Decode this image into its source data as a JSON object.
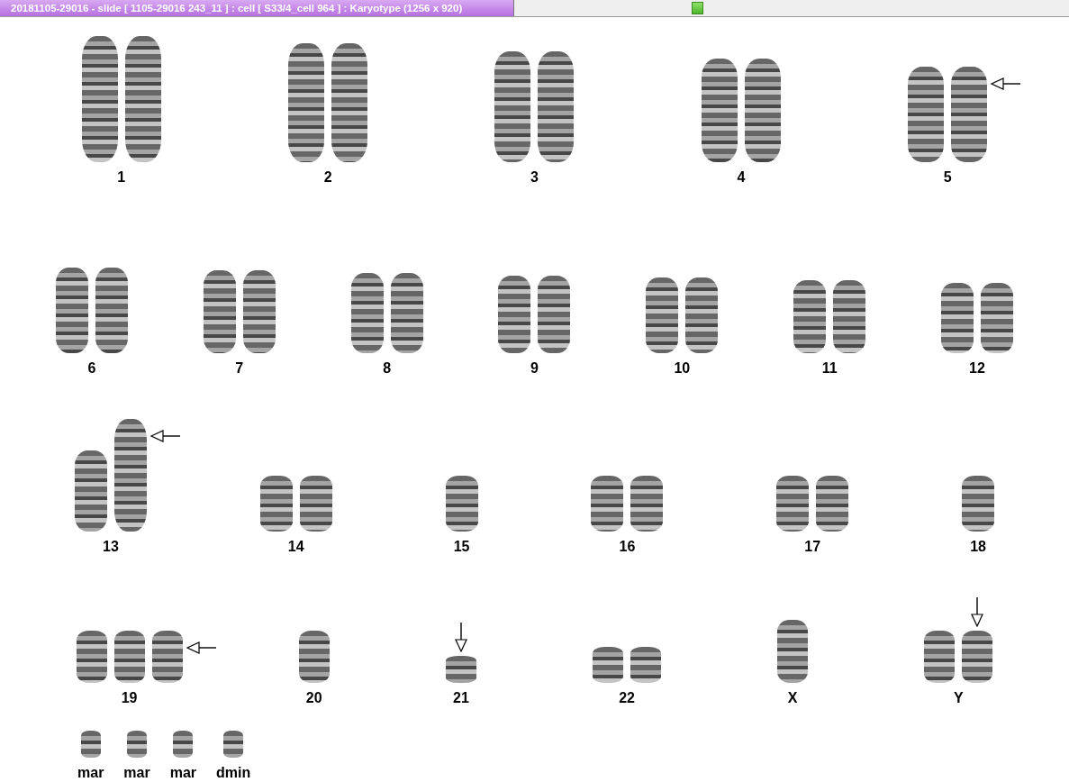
{
  "window": {
    "title": "20181105-29016 - slide [ 1105-29016 243_11 ] : cell [ S33/4_cell 964 ] : Karyotype  (1256 x 920)"
  },
  "rows": [
    {
      "groups": [
        {
          "label": "1",
          "chromosomes": [
            {
              "kind": "plain"
            },
            {
              "kind": "plain"
            }
          ]
        },
        {
          "label": "2",
          "chromosomes": [
            {
              "kind": "plain"
            },
            {
              "kind": "plain"
            }
          ]
        },
        {
          "label": "3",
          "chromosomes": [
            {
              "kind": "plain"
            },
            {
              "kind": "plain"
            }
          ]
        },
        {
          "label": "4",
          "chromosomes": [
            {
              "kind": "plain"
            },
            {
              "kind": "plain"
            }
          ]
        },
        {
          "label": "5",
          "chromosomes": [
            {
              "kind": "plain"
            },
            {
              "kind": "arrowed-side"
            }
          ]
        }
      ]
    },
    {
      "groups": [
        {
          "label": "6",
          "chromosomes": [
            {
              "kind": "plain"
            },
            {
              "kind": "plain"
            }
          ]
        },
        {
          "label": "7",
          "chromosomes": [
            {
              "kind": "plain"
            },
            {
              "kind": "plain"
            }
          ]
        },
        {
          "label": "8",
          "chromosomes": [
            {
              "kind": "plain"
            },
            {
              "kind": "plain"
            }
          ]
        },
        {
          "label": "9",
          "chromosomes": [
            {
              "kind": "plain"
            },
            {
              "kind": "plain"
            }
          ]
        },
        {
          "label": "10",
          "chromosomes": [
            {
              "kind": "plain"
            },
            {
              "kind": "plain"
            }
          ]
        },
        {
          "label": "11",
          "chromosomes": [
            {
              "kind": "plain"
            },
            {
              "kind": "plain"
            }
          ]
        },
        {
          "label": "12",
          "chromosomes": [
            {
              "kind": "plain"
            },
            {
              "kind": "plain"
            }
          ]
        }
      ]
    },
    {
      "groups": [
        {
          "label": "13",
          "chromosomes": [
            {
              "kind": "plain"
            },
            {
              "kind": "arrowed-side"
            }
          ]
        },
        {
          "label": "14",
          "chromosomes": [
            {
              "kind": "plain"
            },
            {
              "kind": "plain"
            }
          ]
        },
        {
          "label": "15",
          "chromosomes": [
            {
              "kind": "plain"
            }
          ]
        },
        {
          "label": "16",
          "chromosomes": [
            {
              "kind": "plain"
            },
            {
              "kind": "plain"
            }
          ]
        },
        {
          "label": "17",
          "chromosomes": [
            {
              "kind": "plain"
            },
            {
              "kind": "plain"
            }
          ]
        },
        {
          "label": "18",
          "chromosomes": [
            {
              "kind": "plain"
            }
          ]
        }
      ]
    },
    {
      "groups": [
        {
          "label": "19",
          "chromosomes": [
            {
              "kind": "plain"
            },
            {
              "kind": "plain"
            },
            {
              "kind": "arrowed-side"
            }
          ]
        },
        {
          "label": "20",
          "chromosomes": [
            {
              "kind": "plain"
            }
          ]
        },
        {
          "label": "21",
          "chromosomes": [
            {
              "kind": "arrowed-top"
            }
          ]
        },
        {
          "label": "22",
          "chromosomes": [
            {
              "kind": "plain"
            },
            {
              "kind": "plain"
            }
          ]
        },
        {
          "label": "X",
          "chromosomes": [
            {
              "kind": "plain"
            }
          ]
        },
        {
          "label": "Y",
          "chromosomes": [
            {
              "kind": "plain"
            },
            {
              "kind": "arrowed-top"
            }
          ]
        }
      ]
    },
    {
      "groups": [
        {
          "label": "mar",
          "chromosomes": [
            {
              "kind": "plain"
            }
          ]
        },
        {
          "label": "mar",
          "chromosomes": [
            {
              "kind": "plain"
            }
          ]
        },
        {
          "label": "mar",
          "chromosomes": [
            {
              "kind": "plain"
            }
          ]
        },
        {
          "label": "dmin",
          "chromosomes": [
            {
              "kind": "plain"
            }
          ]
        }
      ]
    }
  ]
}
